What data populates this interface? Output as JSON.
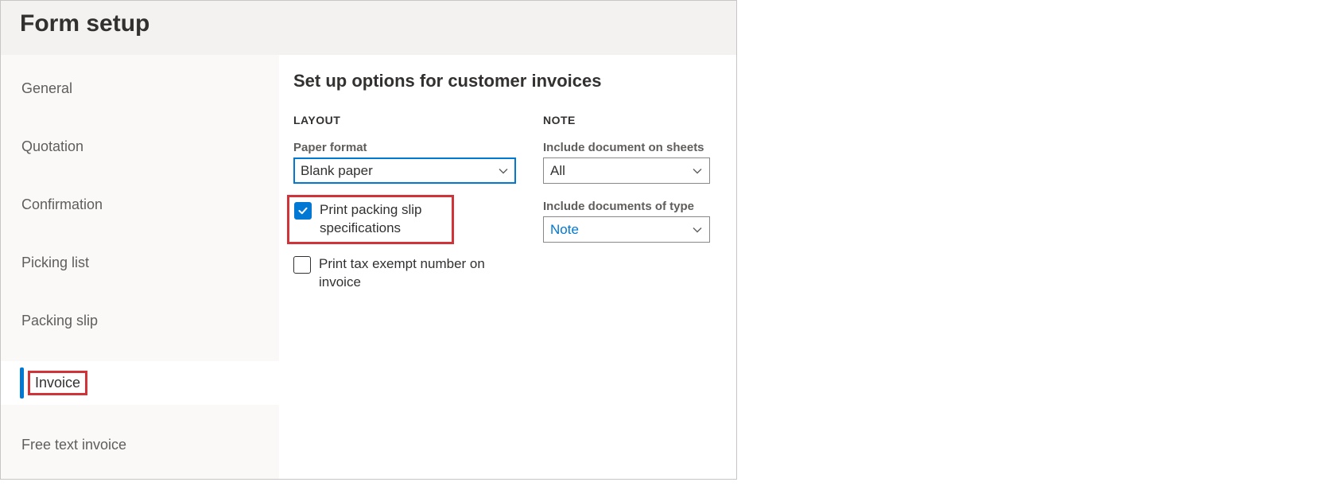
{
  "title": "Form setup",
  "sidebar": {
    "items": [
      {
        "label": "General"
      },
      {
        "label": "Quotation"
      },
      {
        "label": "Confirmation"
      },
      {
        "label": "Picking list"
      },
      {
        "label": "Packing slip"
      },
      {
        "label": "Invoice",
        "active": true,
        "highlighted": true
      },
      {
        "label": "Free text invoice"
      }
    ]
  },
  "main": {
    "heading": "Set up options for customer invoices",
    "layout": {
      "section_label": "LAYOUT",
      "paper_format_label": "Paper format",
      "paper_format_value": "Blank paper",
      "chk_print_packing_slip_label": "Print packing slip specifications",
      "chk_print_packing_slip_checked": true,
      "chk_print_packing_slip_highlighted": true,
      "chk_print_tax_exempt_label": "Print tax exempt number on invoice",
      "chk_print_tax_exempt_checked": false
    },
    "note": {
      "section_label": "NOTE",
      "include_doc_sheets_label": "Include document on sheets",
      "include_doc_sheets_value": "All",
      "include_doc_type_label": "Include documents of type",
      "include_doc_type_value": "Note"
    }
  }
}
